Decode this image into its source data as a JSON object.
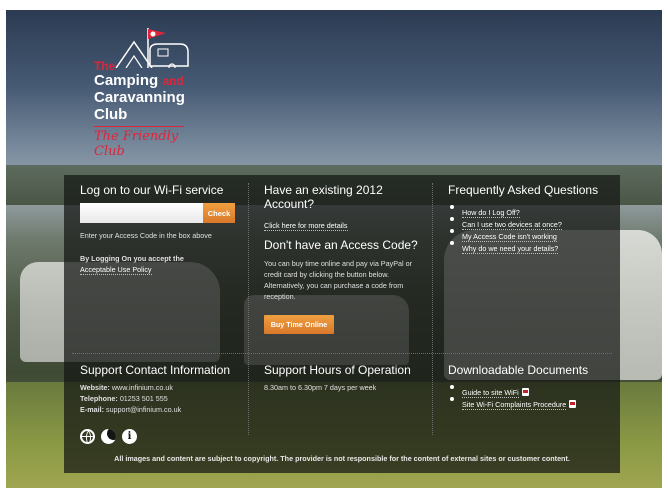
{
  "logo": {
    "line1": "The",
    "line2": "Camping",
    "line2b": "and",
    "line3": "Caravanning",
    "line4": "Club",
    "tagline": "The Friendly Club"
  },
  "logon": {
    "heading": "Log on to our Wi-Fi service",
    "input_value": "",
    "check_label": "Check",
    "hint": "Enter your Access Code in the box above",
    "aup_prefix": "By Logging On you accept the",
    "aup_link": "Acceptable Use Policy"
  },
  "existing": {
    "heading": "Have an existing 2012 Account?",
    "link": "Click here for more details"
  },
  "noaccess": {
    "heading": "Don't have an Access Code?",
    "body": "You can buy time online and pay via PayPal or credit card by clicking the button below. Alternatively, you can purchase a code from reception.",
    "buy_label": "Buy Time Online"
  },
  "faq": {
    "heading": "Frequently Asked Questions",
    "items": [
      "How do I Log Off?",
      "Can I use two devices at once?",
      "My Access Code isn't working",
      "Why do we need your details?"
    ]
  },
  "support": {
    "heading": "Support Contact Information",
    "website_label": "Website:",
    "website": "www.infinium.co.uk",
    "phone_label": "Telephone:",
    "phone": "01253 501 555",
    "email_label": "E-mail:",
    "email": "support@infinium.co.uk"
  },
  "hours": {
    "heading": "Support Hours of Operation",
    "text": "8.30am to 6.30pm 7 days per week"
  },
  "downloads": {
    "heading": "Downloadable Documents",
    "items": [
      "Guide to site WiFi",
      "Site Wi-Fi Complaints Procedure"
    ]
  },
  "footer": {
    "copyright": "All images and content are subject to copyright. The provider is not responsible for the content of external sites or customer content."
  },
  "icons": [
    "globe-icon",
    "moon-icon",
    "info-icon"
  ],
  "info_glyph": "i",
  "colors": {
    "accent_orange": "#e0892f",
    "brand_red": "#e0243a",
    "panel": "#141614"
  }
}
